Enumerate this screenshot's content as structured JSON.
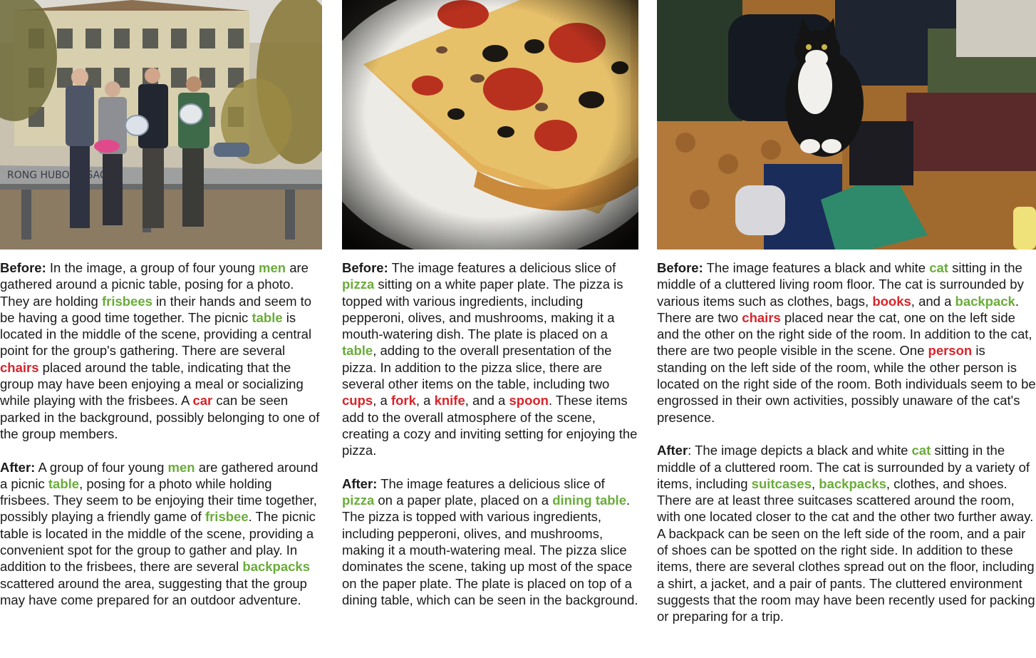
{
  "panels": [
    {
      "before_label": "Before:",
      "before": [
        {
          "t": " In the image, a group of four young "
        },
        {
          "t": "men",
          "c": "g"
        },
        {
          "t": " are gathered around a picnic table, posing for a photo. They are holding "
        },
        {
          "t": "frisbees",
          "c": "g"
        },
        {
          "t": " in their hands and seem to be having a good time together. The picnic "
        },
        {
          "t": "table",
          "c": "g"
        },
        {
          "t": " is located in the middle of the scene, providing a central point for the group's gathering. There are several "
        },
        {
          "t": "chairs",
          "c": "r"
        },
        {
          "t": " placed around the table, indicating that the group may have been enjoying a meal or socializing while playing with the frisbees. A "
        },
        {
          "t": "car",
          "c": "r"
        },
        {
          "t": " can be seen parked in the background, possibly belonging to one of the group members."
        }
      ],
      "after_label": "After:",
      "after": [
        {
          "t": " A group of four young "
        },
        {
          "t": "men",
          "c": "g"
        },
        {
          "t": " are gathered around a picnic "
        },
        {
          "t": "table",
          "c": "g"
        },
        {
          "t": ", posing for a photo while holding frisbees. They seem to be enjoying their time together, possibly playing a friendly game of "
        },
        {
          "t": "frisbee",
          "c": "g"
        },
        {
          "t": ". The picnic table is located in the middle of the scene, providing a convenient spot for the group to gather and play. In addition to the frisbees, there are several "
        },
        {
          "t": "backpacks",
          "c": "g"
        },
        {
          "t": " scattered around the area, suggesting that the group may have come prepared for an outdoor adventure."
        }
      ]
    },
    {
      "before_label": "Before:",
      "before": [
        {
          "t": " The image features a delicious slice of "
        },
        {
          "t": "pizza",
          "c": "g"
        },
        {
          "t": " sitting on a white paper plate. The pizza is topped with various ingredients, including pepperoni, olives, and mushrooms, making it a mouth-watering dish. The plate is placed on a "
        },
        {
          "t": "table",
          "c": "g"
        },
        {
          "t": ", adding to the overall presentation of the pizza.  In addition to the pizza slice, there are several other items on the table, including two "
        },
        {
          "t": "cups",
          "c": "r"
        },
        {
          "t": ", a "
        },
        {
          "t": "fork",
          "c": "r"
        },
        {
          "t": ", a "
        },
        {
          "t": "knife",
          "c": "r"
        },
        {
          "t": ", and a "
        },
        {
          "t": "spoon",
          "c": "r"
        },
        {
          "t": ". These items add to the overall atmosphere of the scene, creating a cozy and inviting setting for enjoying the pizza."
        }
      ],
      "after_label": "After:",
      "after": [
        {
          "t": " The image features a delicious slice of "
        },
        {
          "t": "pizza",
          "c": "g"
        },
        {
          "t": " on a paper plate, placed on a "
        },
        {
          "t": "dining table",
          "c": "g"
        },
        {
          "t": ". The pizza is topped with various ingredients, including pepperoni, olives, and mushrooms, making it a mouth-watering meal. The pizza slice dominates the scene, taking up most of the space on the paper plate. The plate is placed on top of a dining table, which can be seen in the background."
        }
      ]
    },
    {
      "before_label": "Before:",
      "before": [
        {
          "t": " The image features a black and white "
        },
        {
          "t": "cat",
          "c": "g"
        },
        {
          "t": " sitting in the middle of a cluttered living room floor. The cat is surrounded by various items such as clothes, bags, "
        },
        {
          "t": "books",
          "c": "r"
        },
        {
          "t": ", and a "
        },
        {
          "t": "backpack",
          "c": "g"
        },
        {
          "t": ". There are two "
        },
        {
          "t": "chairs",
          "c": "r"
        },
        {
          "t": " placed near the cat, one on the left side and the other on the right side of the room.  In addition to the cat, there are two people visible in the scene. One "
        },
        {
          "t": "person",
          "c": "r"
        },
        {
          "t": " is standing on the left side of the room, while the other person is located on the right side of the room. Both individuals seem to be engrossed in their own activities, possibly unaware of the cat's presence."
        }
      ],
      "after_label": "After",
      "after": [
        {
          "t": ": The image depicts a black and white "
        },
        {
          "t": "cat",
          "c": "g"
        },
        {
          "t": " sitting in the middle of a cluttered room. The cat is surrounded by a variety of items, including "
        },
        {
          "t": "suitcases",
          "c": "g"
        },
        {
          "t": ", "
        },
        {
          "t": "backpacks",
          "c": "g"
        },
        {
          "t": ", clothes, and shoes. There are at least three suitcases scattered around the room, with one located closer to the cat and the other two further away. A backpack can be seen on the left side of the room, and a pair of shoes can be spotted on the right side. In addition to these items, there are several clothes spread out on the floor, including a shirt, a jacket, and a pair of pants. The cluttered environment suggests that the room may have been recently used for packing or preparing for a trip."
        }
      ]
    }
  ],
  "colors": {
    "correct": "#6aac3a",
    "hallucinated": "#d9242a"
  }
}
